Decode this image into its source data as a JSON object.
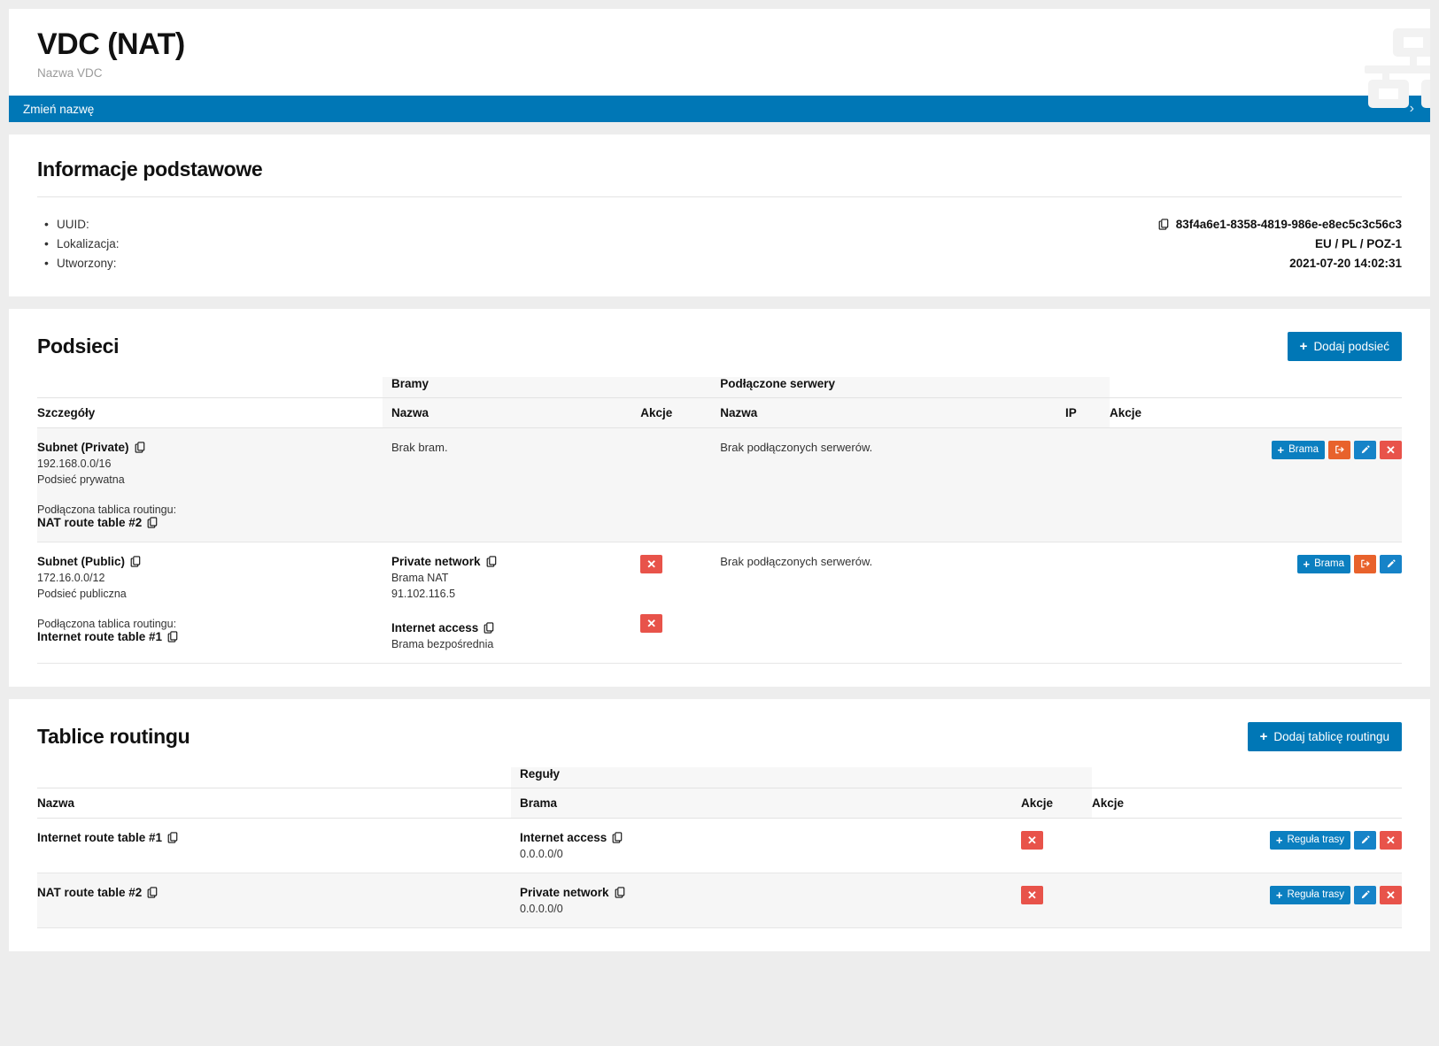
{
  "header": {
    "title": "VDC (NAT)",
    "subtitle": "Nazwa VDC",
    "icon": "sitemap-icon",
    "rename_bar": {
      "label": "Zmień nazwę",
      "chevron": "›"
    }
  },
  "basic_info": {
    "title": "Informacje podstawowe",
    "rows": [
      {
        "label": "UUID:",
        "value": "83f4a6e1-8358-4819-986e-e8ec5c3c56c3",
        "has_copy": true
      },
      {
        "label": "Lokalizacja:",
        "value": "EU / PL / POZ-1",
        "has_copy": false
      },
      {
        "label": "Utworzony:",
        "value": "2021-07-20 14:02:31",
        "has_copy": false
      }
    ]
  },
  "subnets": {
    "title": "Podsieci",
    "add_button": "Dodaj podsieć",
    "group_headers": {
      "gateways": "Bramy",
      "servers": "Podłączone serwery"
    },
    "columns": {
      "details": "Szczegóły",
      "gateway_name": "Nazwa",
      "gateway_actions": "Akcje",
      "server_name": "Nazwa",
      "server_ip": "IP",
      "actions": "Akcje"
    },
    "rows": [
      {
        "name": "Subnet (Private)",
        "cidr": "192.168.0.0/16",
        "type": "Podsieć prywatna",
        "route_table_label": "Podłączona tablica routingu:",
        "route_table": "NAT route table #2",
        "gateways_empty": "Brak bram.",
        "gateways": [],
        "servers_empty": "Brak podłączonych serwerów.",
        "actions": [
          {
            "name": "add-gateway-button",
            "label": "Brama",
            "style": "blue",
            "icon": "plus-icon"
          },
          {
            "name": "detach-button",
            "label": "",
            "style": "orange",
            "icon": "sign-out-icon"
          },
          {
            "name": "edit-button",
            "label": "",
            "style": "editblue",
            "icon": "pencil-icon"
          },
          {
            "name": "delete-button",
            "label": "",
            "style": "red",
            "icon": "times-icon"
          }
        ]
      },
      {
        "name": "Subnet (Public)",
        "cidr": "172.16.0.0/12",
        "type": "Podsieć publiczna",
        "route_table_label": "Podłączona tablica routingu:",
        "route_table": "Internet route table #1",
        "gateways_empty": "",
        "gateways": [
          {
            "name": "Private network",
            "type": "Brama NAT",
            "ip": "91.102.116.5"
          },
          {
            "name": "Internet access",
            "type": "Brama bezpośrednia",
            "ip": ""
          }
        ],
        "servers_empty": "Brak podłączonych serwerów.",
        "actions": [
          {
            "name": "add-gateway-button",
            "label": "Brama",
            "style": "blue",
            "icon": "plus-icon"
          },
          {
            "name": "detach-button",
            "label": "",
            "style": "orange",
            "icon": "sign-out-icon"
          },
          {
            "name": "edit-button",
            "label": "",
            "style": "editblue",
            "icon": "pencil-icon"
          }
        ]
      }
    ]
  },
  "route_tables": {
    "title": "Tablice routingu",
    "add_button": "Dodaj tablicę routingu",
    "group_headers": {
      "rules": "Reguły"
    },
    "columns": {
      "name": "Nazwa",
      "rule_gateway": "Brama",
      "rule_actions": "Akcje",
      "actions": "Akcje"
    },
    "rows": [
      {
        "name": "Internet route table #1",
        "rules": [
          {
            "gateway": "Internet access",
            "cidr": "0.0.0.0/0"
          }
        ],
        "actions": [
          {
            "name": "add-route-rule-button",
            "label": "Reguła trasy",
            "style": "blue",
            "icon": "plus-icon"
          },
          {
            "name": "edit-button",
            "label": "",
            "style": "editblue",
            "icon": "pencil-icon"
          },
          {
            "name": "delete-button",
            "label": "",
            "style": "red",
            "icon": "times-icon"
          }
        ]
      },
      {
        "name": "NAT route table #2",
        "rules": [
          {
            "gateway": "Private network",
            "cidr": "0.0.0.0/0"
          }
        ],
        "actions": [
          {
            "name": "add-route-rule-button",
            "label": "Reguła trasy",
            "style": "blue",
            "icon": "plus-icon"
          },
          {
            "name": "edit-button",
            "label": "",
            "style": "editblue",
            "icon": "pencil-icon"
          },
          {
            "name": "delete-button",
            "label": "",
            "style": "red",
            "icon": "times-icon"
          }
        ]
      }
    ]
  },
  "colors": {
    "accent_blue": "#0077b6",
    "button_blue": "#0b7fc0",
    "orange": "#e8622c",
    "red": "#e8534a",
    "page_bg": "#ededed"
  }
}
